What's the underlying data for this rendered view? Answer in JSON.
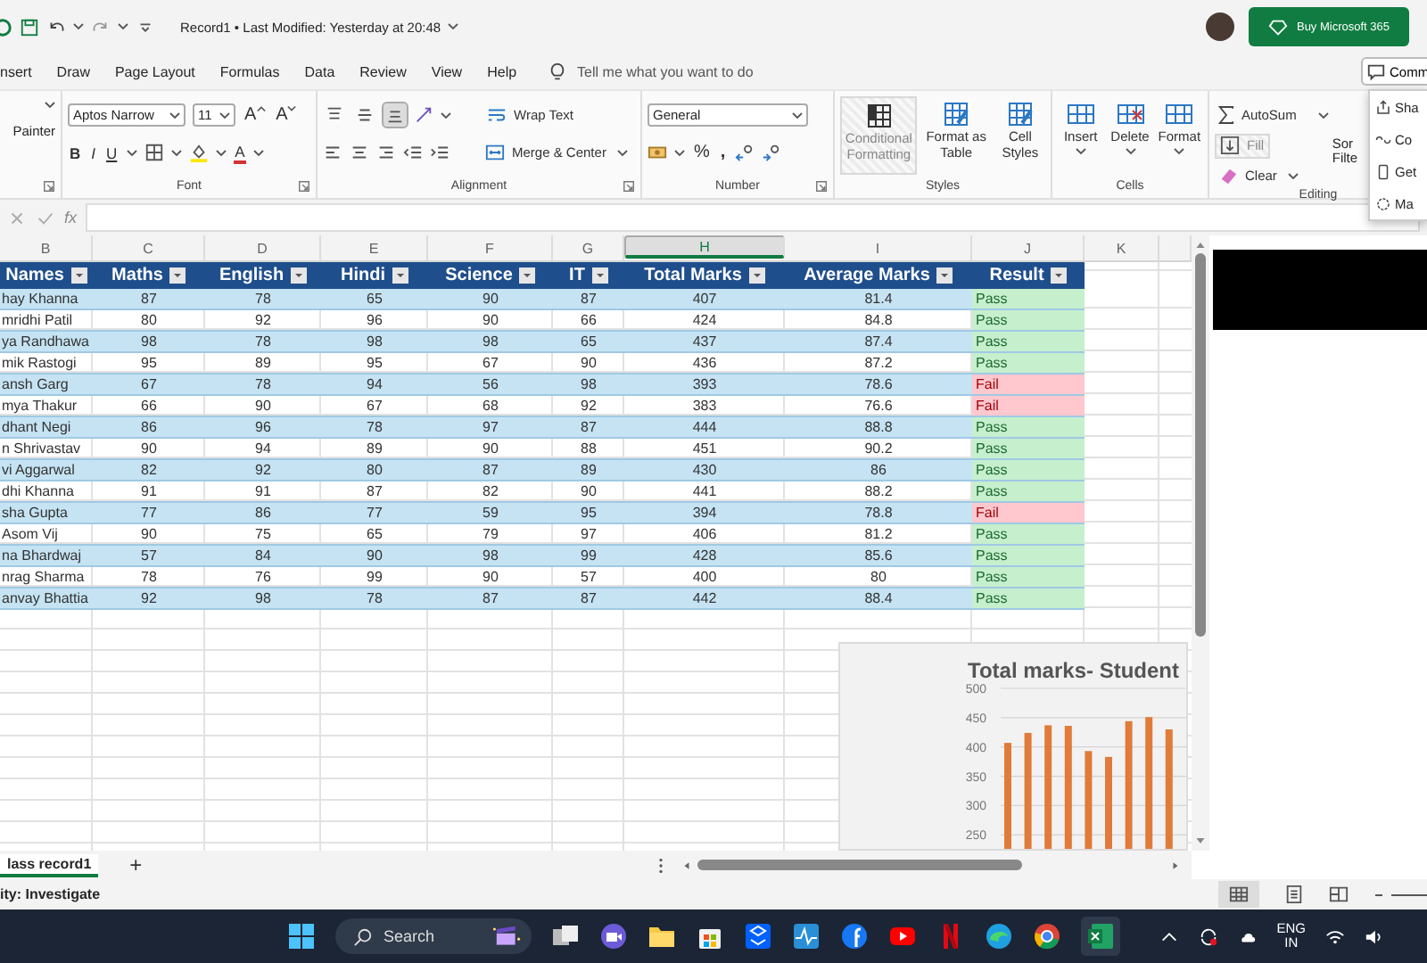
{
  "title_bar": {
    "document_title": "Record1 • Last Modified: Yesterday at 20:48",
    "buy_button": "Buy Microsoft 365"
  },
  "menu_bar": {
    "tabs": [
      "nsert",
      "Draw",
      "Page Layout",
      "Formulas",
      "Data",
      "Review",
      "View",
      "Help"
    ],
    "search_hint": "Tell me what you want to do",
    "comments_button": "Comm"
  },
  "ribbon": {
    "clipboard": {
      "format_painter": "Painter"
    },
    "font": {
      "font_name": "Aptos Narrow",
      "font_size": "11",
      "grow_font": "A",
      "shrink_font": "A",
      "bold": "B",
      "italic": "I",
      "underline": "U",
      "font_color": "A",
      "label": "Font"
    },
    "alignment": {
      "vertical_align": [
        {
          "selected": false
        },
        {
          "selected": false
        },
        {
          "selected": true
        }
      ],
      "wrap_text": "Wrap Text",
      "merge_center": "Merge & Center",
      "label": "Alignment"
    },
    "number": {
      "format": "General",
      "percent": "%",
      "comma": ",",
      "label": "Number"
    },
    "styles": {
      "buttons": [
        {
          "label": "Conditional Formatting",
          "disabled": true
        },
        {
          "label": "Format as Table",
          "disabled": false
        },
        {
          "label": "Cell Styles",
          "disabled": false
        }
      ],
      "label": "Styles"
    },
    "cells": {
      "buttons": [
        "Insert",
        "Delete",
        "Format"
      ],
      "label": "Cells"
    },
    "editing": {
      "autosum": "AutoSum",
      "fill": {
        "label": "Fill",
        "disabled": true
      },
      "clear": "Clear",
      "sort_filter": [
        "Sor",
        "Filte"
      ],
      "label": "Editing"
    }
  },
  "share_menu": {
    "items": [
      "Sha",
      "Co",
      "Get",
      "Ma"
    ]
  },
  "formula_bar": {
    "function_label": "fx"
  },
  "sheet": {
    "columns": [
      {
        "letter": "B",
        "selected": false
      },
      {
        "letter": "C",
        "selected": false
      },
      {
        "letter": "D",
        "selected": false
      },
      {
        "letter": "E",
        "selected": false
      },
      {
        "letter": "F",
        "selected": false
      },
      {
        "letter": "G",
        "selected": false
      },
      {
        "letter": "H",
        "selected": true
      },
      {
        "letter": "I",
        "selected": false
      },
      {
        "letter": "J",
        "selected": false
      },
      {
        "letter": "K",
        "selected": false
      }
    ],
    "table": {
      "headers": [
        "Names",
        "Maths",
        "English",
        "Hindi",
        "Science",
        "IT",
        "Total Marks",
        "Average Marks",
        "Result"
      ],
      "rows": [
        {
          "cells": [
            "hay Khanna",
            "87",
            "78",
            "65",
            "90",
            "87",
            "407",
            "81.4",
            "Pass"
          ],
          "kind": "pass"
        },
        {
          "cells": [
            "mridhi Patil",
            "80",
            "92",
            "96",
            "90",
            "66",
            "424",
            "84.8",
            "Pass"
          ],
          "kind": "pass"
        },
        {
          "cells": [
            "ya Randhawa",
            "98",
            "78",
            "98",
            "98",
            "65",
            "437",
            "87.4",
            "Pass"
          ],
          "kind": "pass"
        },
        {
          "cells": [
            "mik Rastogi",
            "95",
            "89",
            "95",
            "67",
            "90",
            "436",
            "87.2",
            "Pass"
          ],
          "kind": "pass"
        },
        {
          "cells": [
            "ansh Garg",
            "67",
            "78",
            "94",
            "56",
            "98",
            "393",
            "78.6",
            "Fail"
          ],
          "kind": "fail"
        },
        {
          "cells": [
            "mya Thakur",
            "66",
            "90",
            "67",
            "68",
            "92",
            "383",
            "76.6",
            "Fail"
          ],
          "kind": "fail"
        },
        {
          "cells": [
            "dhant Negi",
            "86",
            "96",
            "78",
            "97",
            "87",
            "444",
            "88.8",
            "Pass"
          ],
          "kind": "pass"
        },
        {
          "cells": [
            "n Shrivastav",
            "90",
            "94",
            "89",
            "90",
            "88",
            "451",
            "90.2",
            "Pass"
          ],
          "kind": "pass"
        },
        {
          "cells": [
            "vi Aggarwal",
            "82",
            "92",
            "80",
            "87",
            "89",
            "430",
            "86",
            "Pass"
          ],
          "kind": "pass"
        },
        {
          "cells": [
            "dhi Khanna",
            "91",
            "91",
            "87",
            "82",
            "90",
            "441",
            "88.2",
            "Pass"
          ],
          "kind": "pass"
        },
        {
          "cells": [
            "sha Gupta",
            "77",
            "86",
            "77",
            "59",
            "95",
            "394",
            "78.8",
            "Fail"
          ],
          "kind": "fail"
        },
        {
          "cells": [
            "Asom Vij",
            "90",
            "75",
            "65",
            "79",
            "97",
            "406",
            "81.2",
            "Pass"
          ],
          "kind": "pass"
        },
        {
          "cells": [
            "na Bhardwaj",
            "57",
            "84",
            "90",
            "98",
            "99",
            "428",
            "85.6",
            "Pass"
          ],
          "kind": "pass"
        },
        {
          "cells": [
            "nrag Sharma",
            "78",
            "76",
            "99",
            "90",
            "57",
            "400",
            "80",
            "Pass"
          ],
          "kind": "pass"
        },
        {
          "cells": [
            "anvay Bhattia",
            "92",
            "98",
            "78",
            "87",
            "87",
            "442",
            "88.4",
            "Pass"
          ],
          "kind": "pass"
        }
      ]
    }
  },
  "chart": {
    "chart_data": {
      "type": "bar",
      "grid": true,
      "title": "Total marks- Student",
      "values": [
        407,
        424,
        437,
        436,
        393,
        383,
        444,
        451,
        430
      ],
      "ylim": [
        220,
        500
      ],
      "yticks": [
        250,
        300,
        350,
        400,
        450,
        500
      ]
    }
  },
  "sheet_tabs": {
    "tabs": [
      {
        "label": "lass record1",
        "selected": true
      }
    ],
    "add_button": "+"
  },
  "status_bar": {
    "text": "ity: Investigate"
  },
  "taskbar": {
    "search": "Search",
    "language": "ENG",
    "region": "IN"
  }
}
